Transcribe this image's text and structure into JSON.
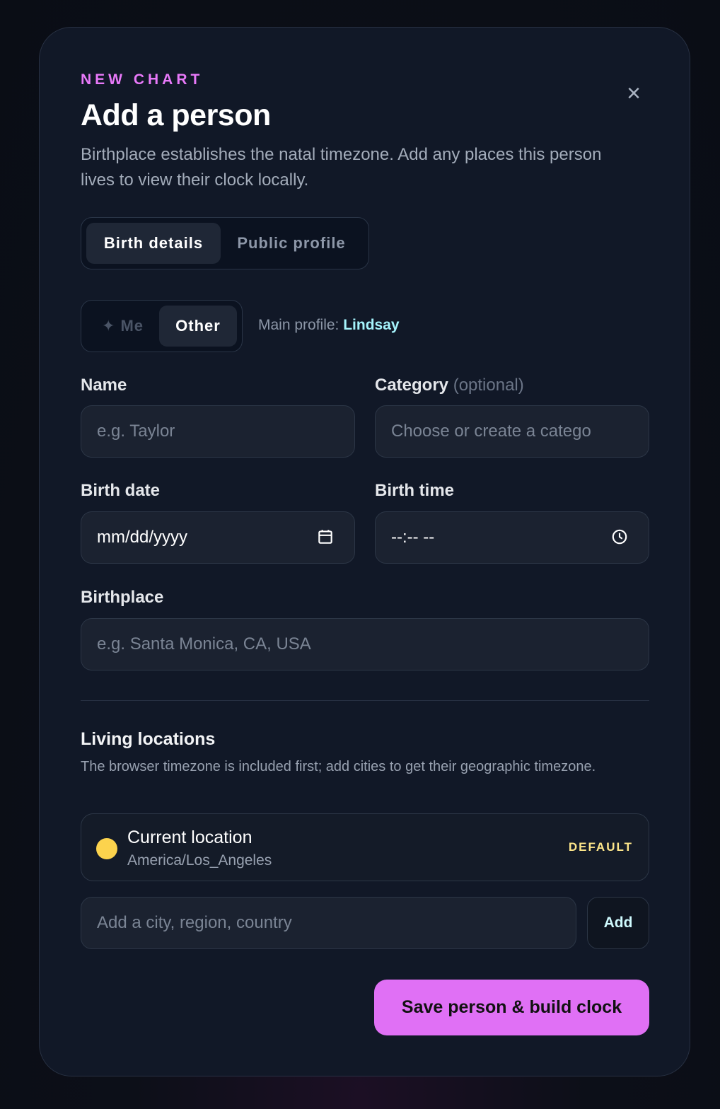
{
  "header": {
    "eyebrow": "NEW CHART",
    "title": "Add a person",
    "subtitle": "Birthplace establishes the natal timezone. Add any places this person lives to view their clock locally.",
    "close_icon": "close-icon"
  },
  "tabs": [
    {
      "label": "Birth details",
      "active": true
    },
    {
      "label": "Public profile",
      "active": false
    }
  ],
  "person_toggle": {
    "options": [
      {
        "label": "✦ Me",
        "active": false
      },
      {
        "label": "Other",
        "active": true
      }
    ],
    "main_profile_label": "Main profile:",
    "main_profile_name": "Lindsay"
  },
  "form": {
    "name": {
      "label": "Name",
      "placeholder": "e.g. Taylor"
    },
    "category": {
      "label": "Category",
      "optional": "(optional)",
      "placeholder": "Choose or create a catego"
    },
    "birth_date": {
      "label": "Birth date",
      "value": "mm/dd/yyyy",
      "icon": "calendar-icon"
    },
    "birth_time": {
      "label": "Birth time",
      "value": "--:-- --",
      "icon": "clock-icon"
    },
    "birthplace": {
      "label": "Birthplace",
      "placeholder": "e.g. Santa Monica, CA, USA"
    }
  },
  "living_locations": {
    "title": "Living locations",
    "description": "The browser timezone is included first; add cities to get their geographic timezone.",
    "items": [
      {
        "name": "Current location",
        "timezone": "America/Los_Angeles",
        "badge": "DEFAULT",
        "dot_color": "#fcd34d"
      }
    ],
    "add_placeholder": "Add a city, region, country",
    "add_label": "Add"
  },
  "footer": {
    "save_label": "Save person & build clock"
  },
  "colors": {
    "accent": "#e070f5",
    "eyebrow": "#e879f9",
    "link": "#a5f3fc",
    "badge": "#fde68a"
  }
}
